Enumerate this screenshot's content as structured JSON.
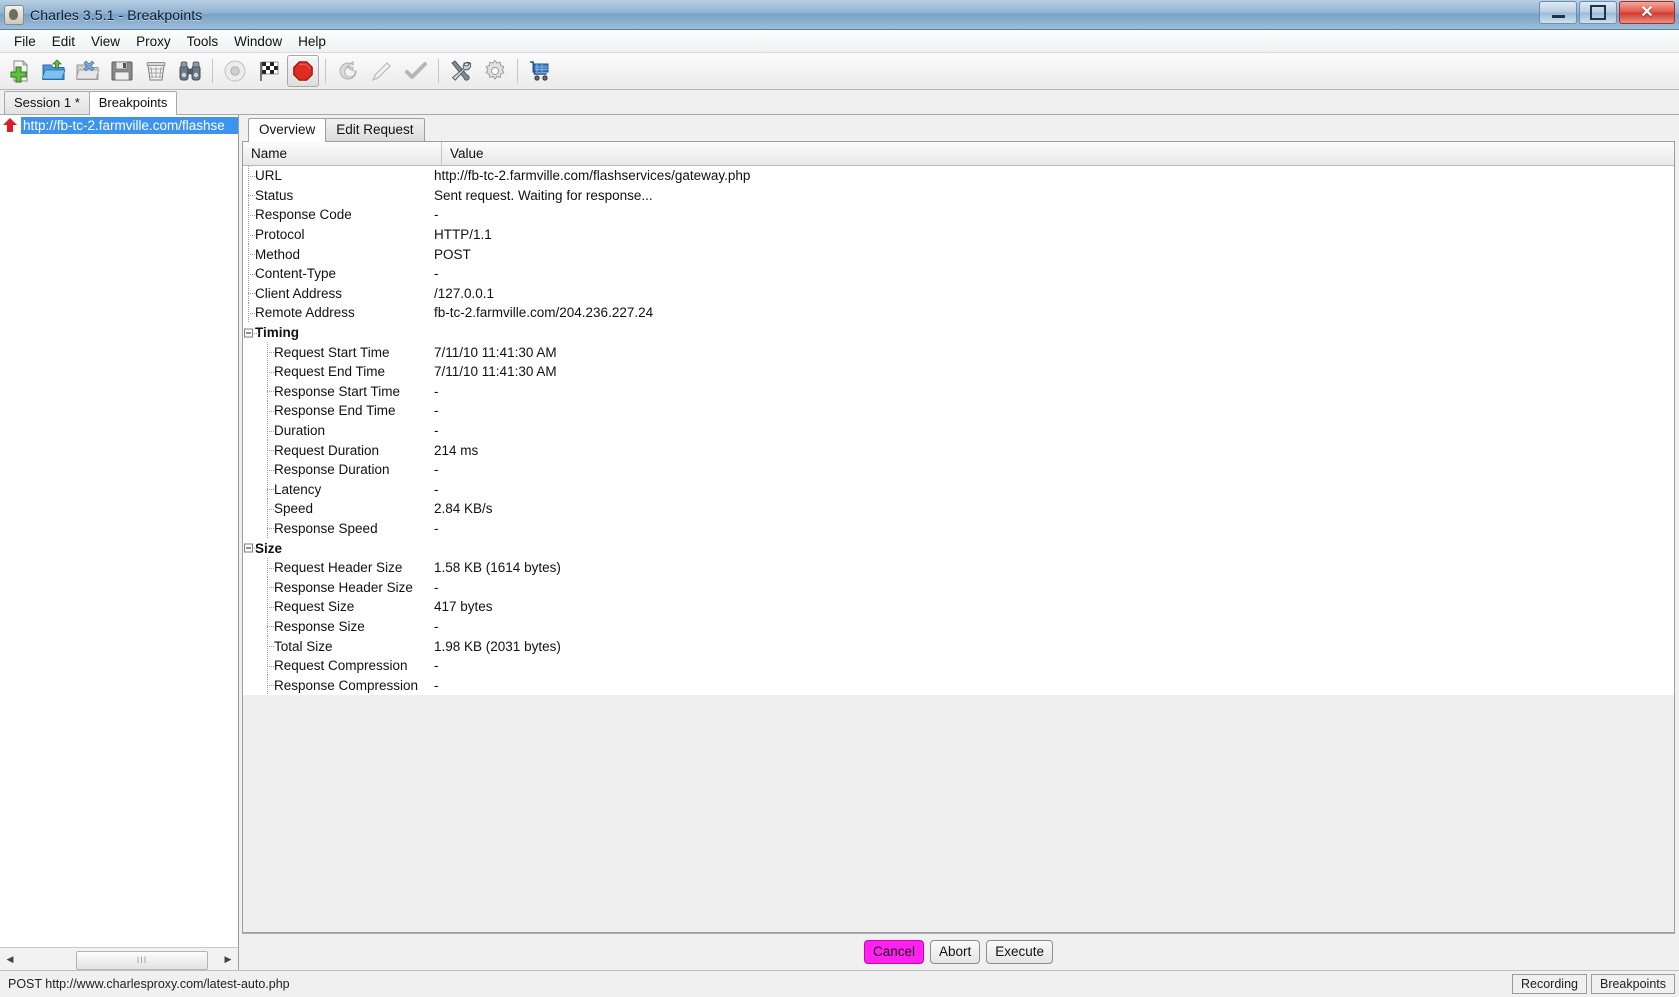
{
  "window": {
    "title": "Charles 3.5.1 - Breakpoints",
    "app_icon": "charles-bottle-icon",
    "controls": [
      {
        "name": "minimize-button",
        "icon": "minimize-icon"
      },
      {
        "name": "maximize-button",
        "icon": "maximize-icon"
      },
      {
        "name": "close-button",
        "icon": "close-icon",
        "label": "✕"
      }
    ]
  },
  "menubar": {
    "items": [
      "File",
      "Edit",
      "View",
      "Proxy",
      "Tools",
      "Window",
      "Help"
    ]
  },
  "toolbar": {
    "buttons": [
      {
        "name": "new-session-button",
        "icon": "new-file-icon",
        "selected": false
      },
      {
        "name": "open-session-button",
        "icon": "open-folder-icon",
        "selected": false
      },
      {
        "name": "close-session-button",
        "icon": "close-folder-icon",
        "selected": false
      },
      {
        "name": "save-session-button",
        "icon": "save-disk-icon",
        "selected": false
      },
      {
        "name": "clear-session-button",
        "icon": "trash-can-icon",
        "selected": false
      },
      {
        "name": "find-button",
        "icon": "binoculars-icon",
        "selected": false
      },
      {
        "name": "record-button",
        "icon": "record-circle-icon",
        "selected": false
      },
      {
        "name": "throttle-button",
        "icon": "checkered-flag-icon",
        "selected": false
      },
      {
        "name": "breakpoints-button",
        "icon": "stop-octagon-icon",
        "selected": true
      },
      {
        "name": "repeat-button",
        "icon": "repeat-arrow-icon",
        "selected": false
      },
      {
        "name": "compose-button",
        "icon": "pencil-icon",
        "selected": false
      },
      {
        "name": "validate-button",
        "icon": "checkmark-icon",
        "selected": false
      },
      {
        "name": "tools-button",
        "icon": "wrench-screwdriver-icon",
        "selected": false
      },
      {
        "name": "settings-button",
        "icon": "gear-icon",
        "selected": false
      },
      {
        "name": "shop-button",
        "icon": "shopping-cart-icon",
        "selected": false
      }
    ]
  },
  "session_tabs": [
    {
      "label": "Session 1 *",
      "active": false,
      "name": "tab-session-1"
    },
    {
      "label": "Breakpoints",
      "active": true,
      "name": "tab-breakpoints"
    }
  ],
  "sidebar": {
    "tree_items": [
      {
        "label": "http://fb-tc-2.farmville.com/flashse",
        "icon": "breakpoint-up-arrow-icon",
        "selected": true
      }
    ],
    "scrollbar": {
      "left_arrow": "◀",
      "right_arrow": "▶",
      "thumb_grip": "III"
    }
  },
  "content_tabs": [
    {
      "label": "Overview",
      "active": true,
      "name": "tab-overview"
    },
    {
      "label": "Edit Request",
      "active": false,
      "name": "tab-edit-request"
    }
  ],
  "table": {
    "columns": [
      "Name",
      "Value"
    ],
    "rows": [
      {
        "level": 1,
        "name": "URL",
        "value": "http://fb-tc-2.farmville.com/flashservices/gateway.php",
        "group": false
      },
      {
        "level": 1,
        "name": "Status",
        "value": "Sent request. Waiting for response...",
        "group": false
      },
      {
        "level": 1,
        "name": "Response Code",
        "value": "-",
        "group": false
      },
      {
        "level": 1,
        "name": "Protocol",
        "value": "HTTP/1.1",
        "group": false
      },
      {
        "level": 1,
        "name": "Method",
        "value": "POST",
        "group": false
      },
      {
        "level": 1,
        "name": "Content-Type",
        "value": "-",
        "group": false
      },
      {
        "level": 1,
        "name": "Client Address",
        "value": "/127.0.0.1",
        "group": false
      },
      {
        "level": 1,
        "name": "Remote Address",
        "value": "fb-tc-2.farmville.com/204.236.227.24",
        "group": false
      },
      {
        "level": 1,
        "name": "Timing",
        "value": "",
        "group": true
      },
      {
        "level": 2,
        "name": "Request Start Time",
        "value": "7/11/10 11:41:30 AM",
        "group": false
      },
      {
        "level": 2,
        "name": "Request End Time",
        "value": "7/11/10 11:41:30 AM",
        "group": false
      },
      {
        "level": 2,
        "name": "Response Start Time",
        "value": "-",
        "group": false
      },
      {
        "level": 2,
        "name": "Response End Time",
        "value": "-",
        "group": false
      },
      {
        "level": 2,
        "name": "Duration",
        "value": "-",
        "group": false
      },
      {
        "level": 2,
        "name": "Request Duration",
        "value": "214 ms",
        "group": false
      },
      {
        "level": 2,
        "name": "Response Duration",
        "value": "-",
        "group": false
      },
      {
        "level": 2,
        "name": "Latency",
        "value": "-",
        "group": false
      },
      {
        "level": 2,
        "name": "Speed",
        "value": "2.84 KB/s",
        "group": false
      },
      {
        "level": 2,
        "name": "Response Speed",
        "value": "-",
        "group": false
      },
      {
        "level": 1,
        "name": "Size",
        "value": "",
        "group": true
      },
      {
        "level": 2,
        "name": "Request Header Size",
        "value": "1.58 KB (1614 bytes)",
        "group": false
      },
      {
        "level": 2,
        "name": "Response Header Size",
        "value": "-",
        "group": false
      },
      {
        "level": 2,
        "name": "Request Size",
        "value": "417 bytes",
        "group": false
      },
      {
        "level": 2,
        "name": "Response Size",
        "value": "-",
        "group": false
      },
      {
        "level": 2,
        "name": "Total Size",
        "value": "1.98 KB (2031 bytes)",
        "group": false
      },
      {
        "level": 2,
        "name": "Request Compression",
        "value": "-",
        "group": false
      },
      {
        "level": 2,
        "name": "Response Compression",
        "value": "-",
        "group": false
      }
    ]
  },
  "actions": [
    {
      "label": "Cancel",
      "name": "cancel-button",
      "style": "magenta"
    },
    {
      "label": "Abort",
      "name": "abort-button",
      "style": "normal"
    },
    {
      "label": "Execute",
      "name": "execute-button",
      "style": "normal"
    }
  ],
  "statusbar": {
    "message": "POST http://www.charlesproxy.com/latest-auto.php",
    "cells": [
      {
        "label": "Recording",
        "name": "status-recording"
      },
      {
        "label": "Breakpoints",
        "name": "status-breakpoints"
      }
    ]
  },
  "colors": {
    "selection_blue": "#3d94f0",
    "cancel_magenta": "#ff22ee",
    "breakpoint_red": "#d61f26"
  }
}
